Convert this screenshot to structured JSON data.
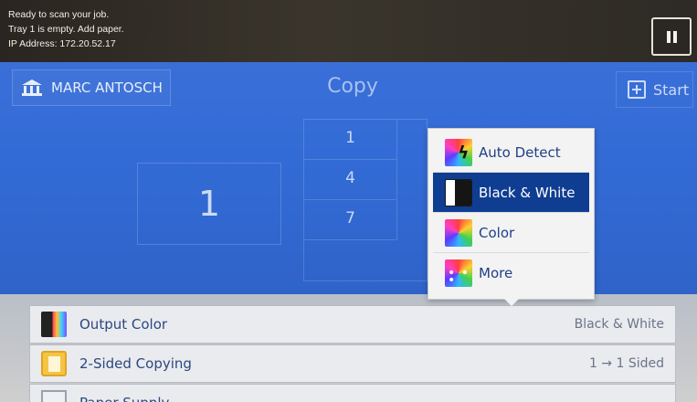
{
  "status": {
    "lines": [
      "Ready to scan your job.",
      "Tray 1 is empty.  Add paper.",
      "IP Address: 172.20.52.17"
    ]
  },
  "header": {
    "user_name": "MARC ANTOSCH",
    "title": "Copy",
    "start_label": "Start"
  },
  "quantity": "1",
  "keypad": {
    "keys": [
      "1",
      "4",
      "7"
    ]
  },
  "dropdown": {
    "items": [
      {
        "label": "Auto Detect",
        "icon": "auto-detect-icon"
      },
      {
        "label": "Black & White",
        "icon": "black-white-icon",
        "selected": true
      },
      {
        "label": "Color",
        "icon": "color-icon"
      },
      {
        "label": "More",
        "icon": "more-icon"
      }
    ]
  },
  "settings": {
    "rows": [
      {
        "label": "Output Color",
        "value": "Black & White",
        "icon": "output-color-icon"
      },
      {
        "label": "2-Sided Copying",
        "value": "1 → 1 Sided",
        "icon": "two-sided-icon"
      },
      {
        "label": "Paper Supply",
        "value": "",
        "icon": "paper-supply-icon"
      }
    ]
  },
  "colors": {
    "main_blue": "#336bd6",
    "selected_item": "#0f3d91",
    "item_text": "#1e3f86"
  }
}
